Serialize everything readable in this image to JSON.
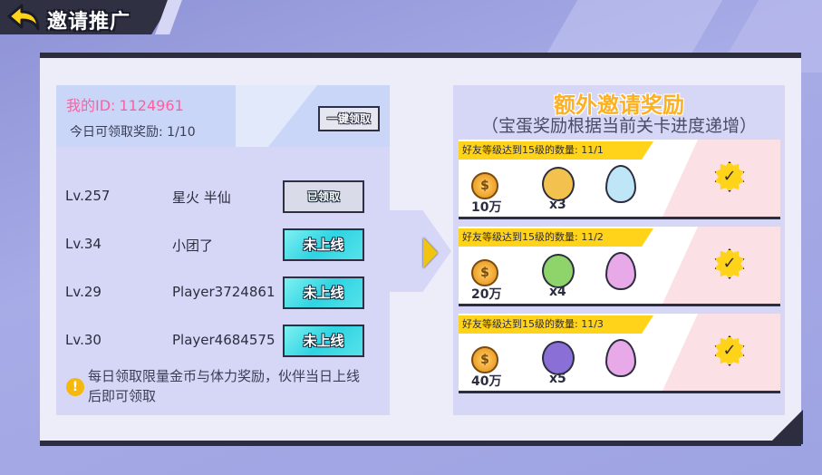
{
  "header": {
    "title": "邀请推广"
  },
  "invite": {
    "my_id_label": "我的ID:",
    "my_id_value": "1124961",
    "today_claim": "今日可领取奖励: 1/10",
    "claim_all_label": "一键领取"
  },
  "friends": [
    {
      "level": "Lv.257",
      "name": "星火 半仙",
      "button": "已领取",
      "state": "claimed"
    },
    {
      "level": "Lv.34",
      "name": "小团了",
      "button": "未上线",
      "state": "offline"
    },
    {
      "level": "Lv.29",
      "name": "Player3724861",
      "button": "未上线",
      "state": "offline"
    },
    {
      "level": "Lv.30",
      "name": "Player4684575",
      "button": "未上线",
      "state": "offline"
    }
  ],
  "note": "每日领取限量金币与体力奖励，伙伴当日上线后即可领取",
  "extra_rewards": {
    "title": "额外邀请奖励",
    "subtitle": "（宝蛋奖励根据当前关卡进度递增）",
    "tiers": [
      {
        "label": "好友等级达到15级的数量: 11/1",
        "coin_qty": "10万",
        "char_qty": "x3",
        "egg_color": "#bfe6f7",
        "char_color": "#f2c14e",
        "check_icon": "check-badge-icon"
      },
      {
        "label": "好友等级达到15级的数量: 11/2",
        "coin_qty": "20万",
        "char_qty": "x4",
        "egg_color": "#e7a9e8",
        "char_color": "#8fd36b",
        "check_icon": "check-badge-icon"
      },
      {
        "label": "好友等级达到15级的数量: 11/3",
        "coin_qty": "40万",
        "char_qty": "x5",
        "egg_color": "#e7a9e8",
        "char_color": "#8a6fd6",
        "check_icon": "check-badge-icon"
      }
    ]
  },
  "colors": {
    "accent_gold": "#ffb020",
    "id_pink": "#ff5fa0",
    "button_cyan": "#2fd4e2",
    "panel_dark": "#2c2d3e"
  }
}
